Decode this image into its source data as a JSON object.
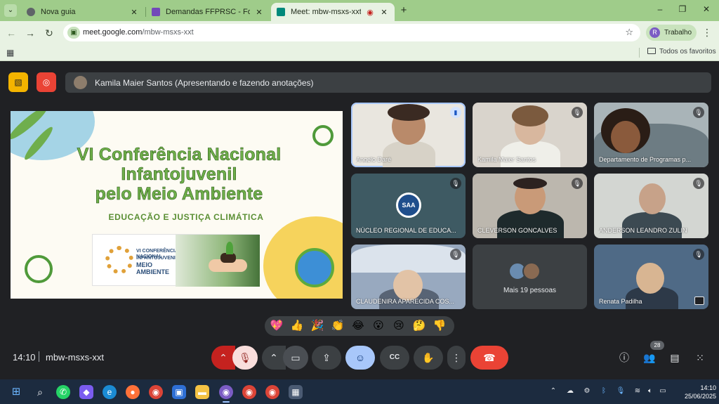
{
  "browser": {
    "tabs": [
      {
        "label": "Nova guia",
        "favicon_color": "#5f6368",
        "active": false
      },
      {
        "label": "Demandas FFPRSC - Formulário",
        "favicon_color": "#7248b9",
        "active": false
      },
      {
        "label": "Meet: mbw-msxs-xxt",
        "favicon_color": "#00897b",
        "active": true
      }
    ],
    "new_tab_glyph": "+",
    "window_controls": [
      "–",
      "❐",
      "✕"
    ],
    "url_host": "meet.google.com",
    "url_path": "/mbw-msxs-xxt",
    "profile_initial": "R",
    "profile_label": "Trabalho",
    "bookmarks_folder": "Todos os favoritos",
    "accent": "#9fcc8a"
  },
  "meet": {
    "presenter_label": "Kamila Maier Santos (Apresentando e fazendo anotações)",
    "slide": {
      "title_line1": "VI Conferência Nacional",
      "title_line2": "Infantojuvenil",
      "title_line3": "pelo Meio Ambiente",
      "subtitle": "EDUCAÇÃO E JUSTIÇA CLIMÁTICA",
      "logo_line1": "VI CONFERÊNCIA NACIONAL",
      "logo_line2": "INFANTOJUVENIL",
      "logo_line3": "MEIO AMBIENTE"
    },
    "participants": [
      {
        "name": "Angelo Daré",
        "mic": "speaking"
      },
      {
        "name": "Kamila Maier Santos",
        "mic": "muted"
      },
      {
        "name": "Departamento de Programas p...",
        "mic": "muted"
      },
      {
        "name": "NÚCLEO REGIONAL DE EDUCA...",
        "mic": "muted",
        "logo_text": "SAA"
      },
      {
        "name": "CLEVERSON GONCALVES",
        "mic": "muted"
      },
      {
        "name": "ANDERSON LEANDRO ZULIN",
        "mic": "muted"
      },
      {
        "name": "CLAUDENIRA APARECIDA COS...",
        "mic": "muted"
      },
      {
        "name": "Renata Padilha",
        "mic": "muted"
      }
    ],
    "more_people": "Mais 19 pessoas",
    "reactions": [
      "💖",
      "👍",
      "🎉",
      "👏",
      "😂",
      "😮",
      "😢",
      "🤔",
      "👎"
    ],
    "time": "14:10",
    "meeting_code": "mbw-msxs-xxt",
    "participant_count": "28",
    "colors": {
      "background": "#202124",
      "tile": "#3c4043",
      "hangup": "#ea4335",
      "reaction_active": "#a8c7fa",
      "mic_muted": "#f9dedc",
      "speaking_outline": "#a8c7fa"
    }
  },
  "taskbar": {
    "clock_time": "14:10",
    "clock_date": "25/06/2025"
  }
}
